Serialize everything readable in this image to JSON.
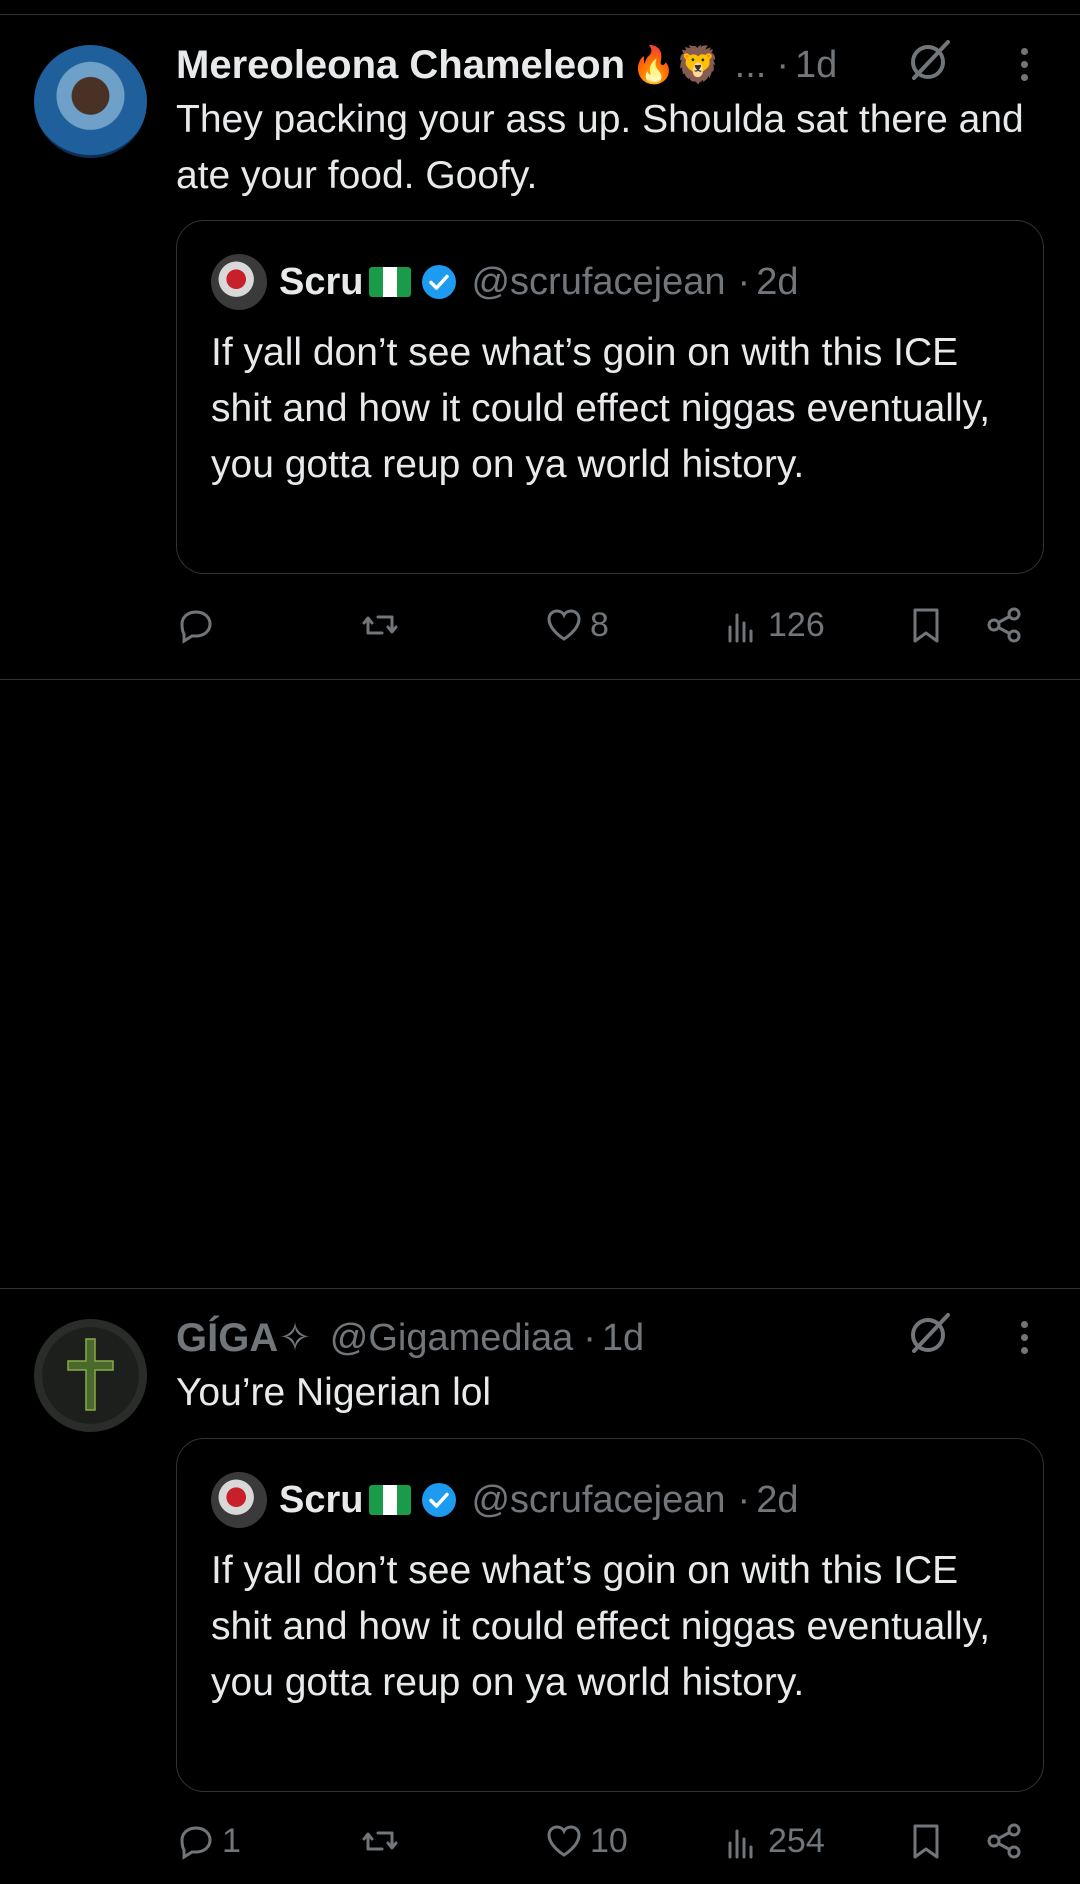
{
  "tweets": [
    {
      "display_name": "Mereoleona Chameleon",
      "emojis": "🔥🦁",
      "ellipsis": "...",
      "dot": "·",
      "time": "1d",
      "text": "They packing your ass up. Shoulda sat there and ate your food. Goofy.",
      "quote": {
        "name": "Scru",
        "handle": "@scrufacejean",
        "dot": "·",
        "time": "2d",
        "text": "If yall don’t see what’s goin on with this ICE shit and how it could effect niggas eventually, you gotta reup on ya world history."
      },
      "actions": {
        "replies": "",
        "reposts": "",
        "likes": "8",
        "views": "126"
      }
    },
    {
      "display_name": "GÍGA✧",
      "handle": "@Gigamediaa",
      "dot": "·",
      "time": "1d",
      "text": "You’re Nigerian lol",
      "quote": {
        "name": "Scru",
        "handle": "@scrufacejean",
        "dot": "·",
        "time": "2d",
        "text": "If yall don’t see what’s goin on with this ICE shit and how it could effect niggas eventually, you gotta reup on ya world history."
      },
      "actions": {
        "replies": "1",
        "reposts": "",
        "likes": "10",
        "views": "254"
      }
    }
  ],
  "colors": {
    "background": "#000000",
    "text": "#e7e9ea",
    "muted": "#71767b",
    "border": "#2f3336",
    "verified": "#1d9bf0",
    "flag_green": "#1a9b4a"
  },
  "icons": [
    "grok-icon",
    "more-icon",
    "reply-icon",
    "repost-icon",
    "like-icon",
    "views-icon",
    "bookmark-icon",
    "share-icon",
    "verified-badge-icon",
    "nigeria-flag-icon"
  ]
}
